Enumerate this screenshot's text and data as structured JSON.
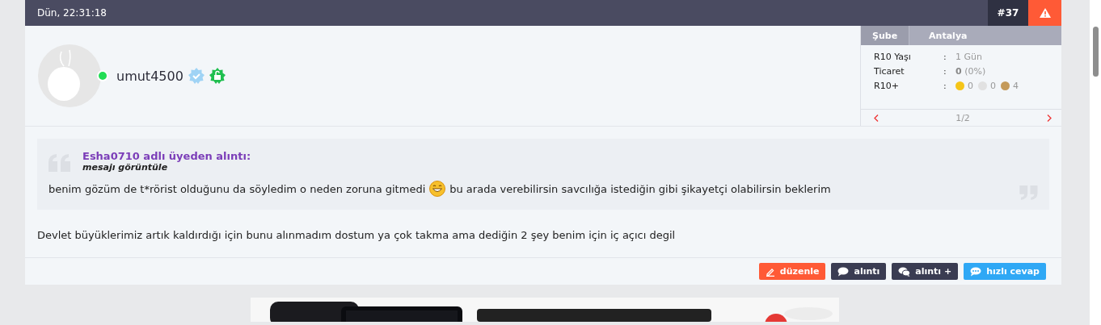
{
  "post": {
    "date": "Dün, 22:31:18",
    "number": "#37"
  },
  "user": {
    "name": "umut4500",
    "online": true
  },
  "info_panel": {
    "tabs": [
      {
        "label": "Şube",
        "selected": true
      },
      {
        "label": "Antalya",
        "selected": false
      }
    ],
    "rows": [
      {
        "kind": "text",
        "label": "R10 Yaşı",
        "separator": ":",
        "value": "1 Gün"
      },
      {
        "kind": "text",
        "label": "Ticaret",
        "separator": ":",
        "value": "**0** (0%)"
      },
      {
        "kind": "medals",
        "label": "R10+",
        "separator": ":",
        "medals": [
          {
            "color": "#f5c518",
            "count": "0"
          },
          {
            "color": "#e1e1e1",
            "count": "0"
          },
          {
            "color": "#c49a5a",
            "count": "4"
          }
        ]
      }
    ],
    "pager": "1/2"
  },
  "quote": {
    "author": "Esha0710 adlı üyeden alıntı:",
    "link": "mesajı görüntüle",
    "text_before": "benim gözüm de t*rörist olduğunu da söyledim o neden zoruna gitmedi",
    "text_after": "bu arada verebilirsin savcılığa istediğin gibi şikayetçi olabilirsin beklerim"
  },
  "message": "Devlet büyüklerimiz artık kaldırdığı için bunu alınmadım dostum ya çok takma ama dediğin 2 şey benim için iç açıcı degil",
  "actions": [
    {
      "kind": "edit",
      "label": "düzenle"
    },
    {
      "kind": "quote",
      "label": "alıntı"
    },
    {
      "kind": "multiquote",
      "label": "alıntı +"
    },
    {
      "kind": "reply",
      "label": "hızlı cevap"
    }
  ]
}
